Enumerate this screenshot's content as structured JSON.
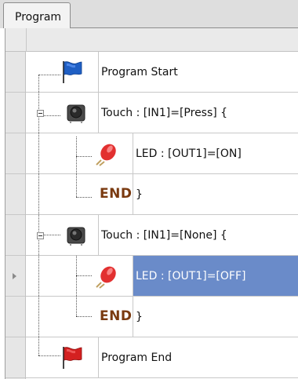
{
  "tab": {
    "label": "Program"
  },
  "rows": [
    {
      "label": "Program Start"
    },
    {
      "label": "Touch : [IN1]=[Press] {"
    },
    {
      "label": "LED : [OUT1]=[ON]"
    },
    {
      "label": "}",
      "end_word": "END"
    },
    {
      "label": "Touch : [IN1]=[None] {"
    },
    {
      "label": "LED : [OUT1]=[OFF]",
      "selected": true
    },
    {
      "label": "}",
      "end_word": "END"
    },
    {
      "label": "Program End"
    }
  ],
  "colors": {
    "selection": "#6a8bc9",
    "start_flag": "#1f5fc4",
    "end_flag": "#d42020",
    "led": "#e23030",
    "end_word": "#7a3a10"
  },
  "icons": [
    "blue-flag-icon",
    "touch-sensor-icon",
    "led-icon",
    "red-flag-icon",
    "collapse-icon",
    "row-pointer-icon"
  ]
}
